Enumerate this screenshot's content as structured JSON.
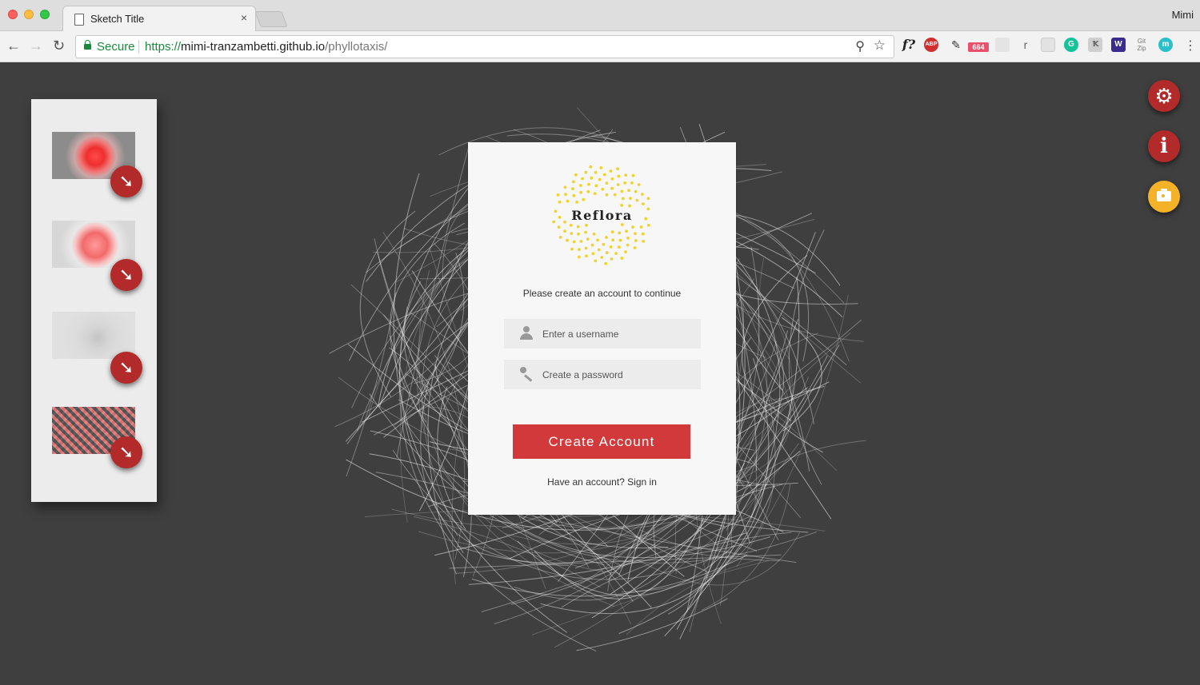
{
  "browser": {
    "tab_title": "Sketch Title",
    "tab_close": "×",
    "profile_name": "Mimi",
    "secure_label": "Secure",
    "url_scheme": "https://",
    "url_host": "mimi-tranzambetti.github.io",
    "url_path": "/phyllotaxis/",
    "extensions": {
      "fx_label": "f?",
      "abp_label": "ABP",
      "badge_count": "664",
      "r_label": "r",
      "g_label": "G",
      "w_label": "W",
      "gitzip_label": "Git Zip",
      "m_label": "m"
    }
  },
  "sidebar": {
    "items": [
      {
        "name": "thumbnail-1",
        "download_icon": "arrow-down-icon"
      },
      {
        "name": "thumbnail-2",
        "download_icon": "arrow-down-icon"
      },
      {
        "name": "thumbnail-3",
        "download_icon": "arrow-down-icon"
      },
      {
        "name": "thumbnail-4",
        "download_icon": "arrow-down-icon"
      }
    ],
    "download_glyph": "➘"
  },
  "card": {
    "brand": "Reflora",
    "subtitle": "Please create an account to continue",
    "username_placeholder": "Enter a username",
    "password_placeholder": "Create a password",
    "create_button": "Create Account",
    "signin_text": "Have an account? Sign in"
  },
  "fabs": {
    "settings_glyph": "⚙",
    "info_glyph": "i"
  },
  "colors": {
    "page_bg": "#3f3f3f",
    "accent_red": "#d2393a",
    "fab_red": "#b22a2a",
    "fab_yellow": "#f3b227",
    "logo_dots": "#f2d22e"
  }
}
